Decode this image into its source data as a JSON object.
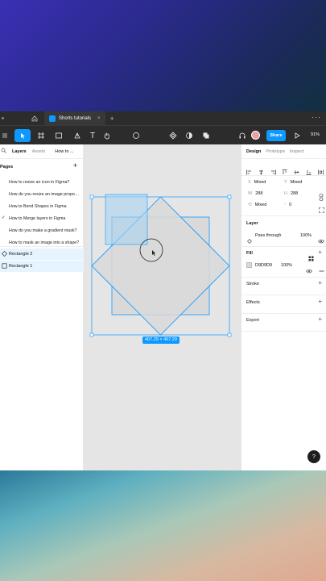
{
  "window": {
    "tab_title": "Shorts tutorials",
    "tab_close": "×",
    "new_tab": "+",
    "more": "···"
  },
  "toolbar": {
    "share_label": "Share",
    "zoom": "91%",
    "text_tool": "T"
  },
  "left_panel": {
    "tabs": [
      "Layers",
      "Assets",
      "How to ..."
    ],
    "pages_label": "Pages",
    "add_page": "+",
    "pages": [
      {
        "label": "How to resize an icon in Figma?",
        "current": false
      },
      {
        "label": "How do you resize an image proportionally?",
        "current": false
      },
      {
        "label": "How to Bend Shapes in Figma",
        "current": false
      },
      {
        "label": "How to Merge layers in Figma",
        "current": true
      },
      {
        "label": "How do you make a gradient mask?",
        "current": false
      },
      {
        "label": "How to mask an image into a shape?",
        "current": false
      }
    ],
    "current_mark": "✓",
    "layers": [
      {
        "label": "Rectangle 2",
        "icon": "diamond-icon"
      },
      {
        "label": "Rectangle 1",
        "icon": "square-icon"
      }
    ]
  },
  "canvas": {
    "selection_size": "407.29 × 407.29",
    "fill_color": "#D9D9D9",
    "selection_color": "#0D99FF"
  },
  "right_panel": {
    "tabs": [
      "Design",
      "Prototype",
      "Inspect"
    ],
    "x": {
      "label": "X",
      "value": "Mixed"
    },
    "y": {
      "label": "Y",
      "value": "Mixed"
    },
    "w": {
      "label": "W",
      "value": "288"
    },
    "h": {
      "label": "H",
      "value": "288"
    },
    "rotation": {
      "label": "⟲",
      "value": "Mixed"
    },
    "radius": {
      "label": "◜",
      "value": "0"
    },
    "layer_title": "Layer",
    "blend_mode": "Pass through",
    "layer_opacity": "100%",
    "fill_title": "Fill",
    "fill_hex": "D9D9D9",
    "fill_opacity": "100%",
    "stroke_title": "Stroke",
    "effects_title": "Effects",
    "export_title": "Export",
    "help": "?"
  }
}
